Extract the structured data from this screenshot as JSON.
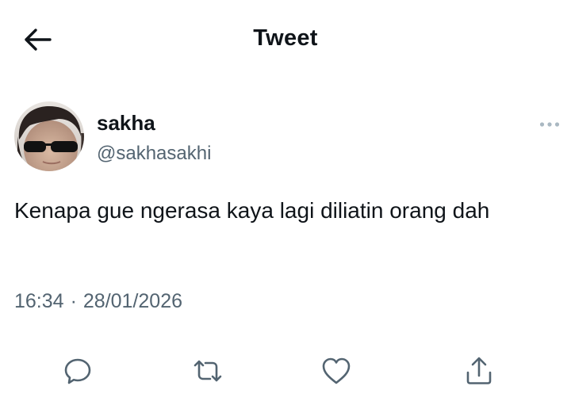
{
  "header": {
    "back_icon": "arrow-left-icon",
    "title": "Tweet"
  },
  "tweet": {
    "author": {
      "display_name": "sakha",
      "username": "@sakhasakhi",
      "avatar": "profile-photo"
    },
    "more_icon": "more-horizontal-icon",
    "text": "Kenapa gue ngerasa kaya lagi diliatin orang dah",
    "time": "16:34",
    "separator": "·",
    "date": "28/01/2026"
  },
  "actions": [
    {
      "icon": "reply-icon"
    },
    {
      "icon": "retweet-icon"
    },
    {
      "icon": "like-icon"
    },
    {
      "icon": "share-icon"
    }
  ],
  "colors": {
    "text_primary": "#0f1419",
    "text_secondary": "#536471",
    "background": "#ffffff"
  }
}
